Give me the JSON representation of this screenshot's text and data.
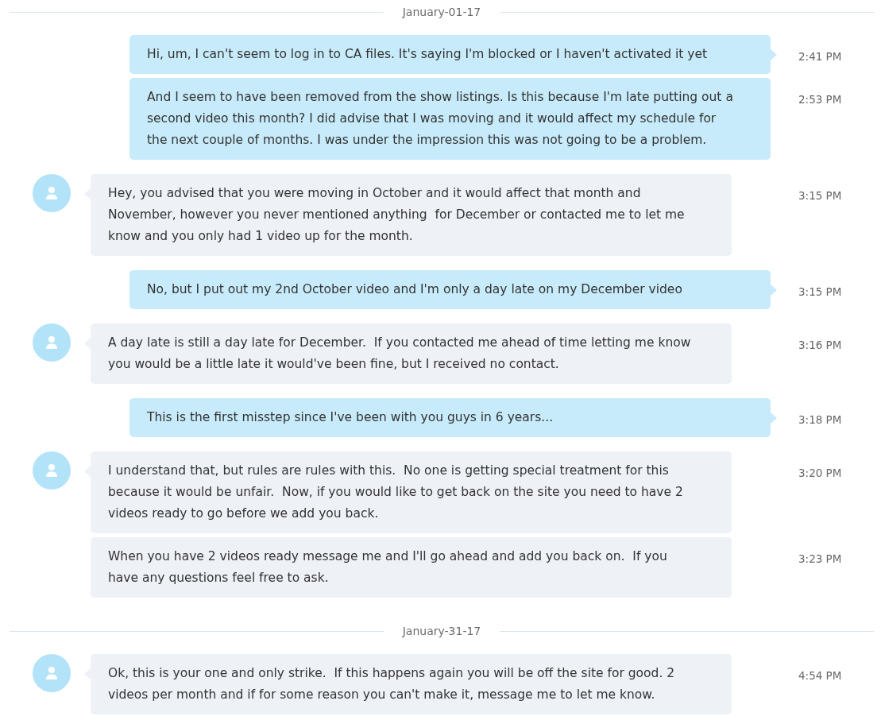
{
  "sections": [
    {
      "date": "January-01-17",
      "messages": [
        {
          "kind": "outgoing",
          "first": true,
          "text": "Hi, um, I can't seem to log in to CA files. It's saying I'm blocked or I haven't activated it yet",
          "time": "2:41 PM"
        },
        {
          "kind": "outgoing",
          "first": false,
          "text": "And I seem to have been removed from the show listings. Is this because I'm late putting out a second video this month? I did advise that I was moving and it would affect my schedule for the next couple of months. I was under the impression this was not going to be a problem.",
          "time": "2:53 PM"
        },
        {
          "kind": "incoming",
          "first": true,
          "text": "Hey, you advised that you were moving in October and it would affect that month and November, however you never mentioned anything  for December or contacted me to let me know and you only had 1 video up for the month.",
          "time": "3:15 PM"
        },
        {
          "kind": "outgoing",
          "first": true,
          "text": "No, but I put out my 2nd October video and I'm only a day late on my December video",
          "time": "3:15 PM"
        },
        {
          "kind": "incoming",
          "first": true,
          "text": "A day late is still a day late for December.  If you contacted me ahead of time letting me know you would be a little late it would've been fine, but I received no contact.",
          "time": "3:16 PM"
        },
        {
          "kind": "outgoing",
          "first": true,
          "text": "This is the first misstep since I've been with you guys in 6 years...",
          "time": "3:18 PM"
        },
        {
          "kind": "incoming",
          "first": true,
          "text": "I understand that, but rules are rules with this.  No one is getting special treatment for this because it would be unfair.  Now, if you would like to get back on the site you need to have 2 videos ready to go before we add you back.",
          "time": "3:20 PM"
        },
        {
          "kind": "incoming",
          "first": false,
          "text": "When you have 2 videos ready message me and I'll go ahead and add you back on.  If you have any questions feel free to ask.",
          "time": "3:23 PM"
        }
      ]
    },
    {
      "date": "January-31-17",
      "messages": [
        {
          "kind": "incoming",
          "first": true,
          "text": "Ok, this is your one and only strike.  If this happens again you will be off the site for good. 2 videos per month and if for some reason you can't make it, message me to let me know.",
          "time": "4:54 PM"
        }
      ]
    }
  ]
}
